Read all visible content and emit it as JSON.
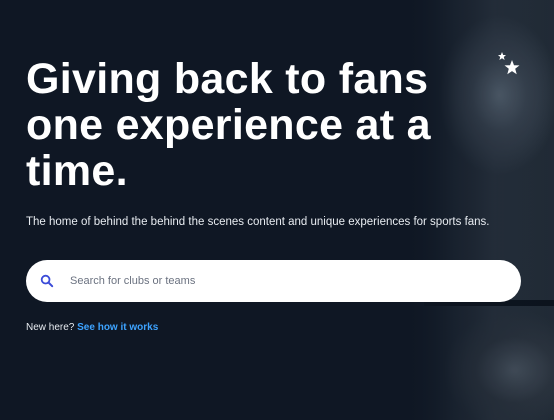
{
  "hero": {
    "headline": "Giving back to fans one experience at a time.",
    "subtitle": "The home of behind the behind the scenes content and unique experiences for sports fans."
  },
  "search": {
    "placeholder": "Search for clubs or teams",
    "value": "",
    "icon": "search-icon"
  },
  "footer": {
    "prompt": "New here?",
    "link_label": "See how it works"
  },
  "colors": {
    "background": "#0f1724",
    "link": "#3da3ff",
    "search_icon": "#3b4bd8"
  }
}
